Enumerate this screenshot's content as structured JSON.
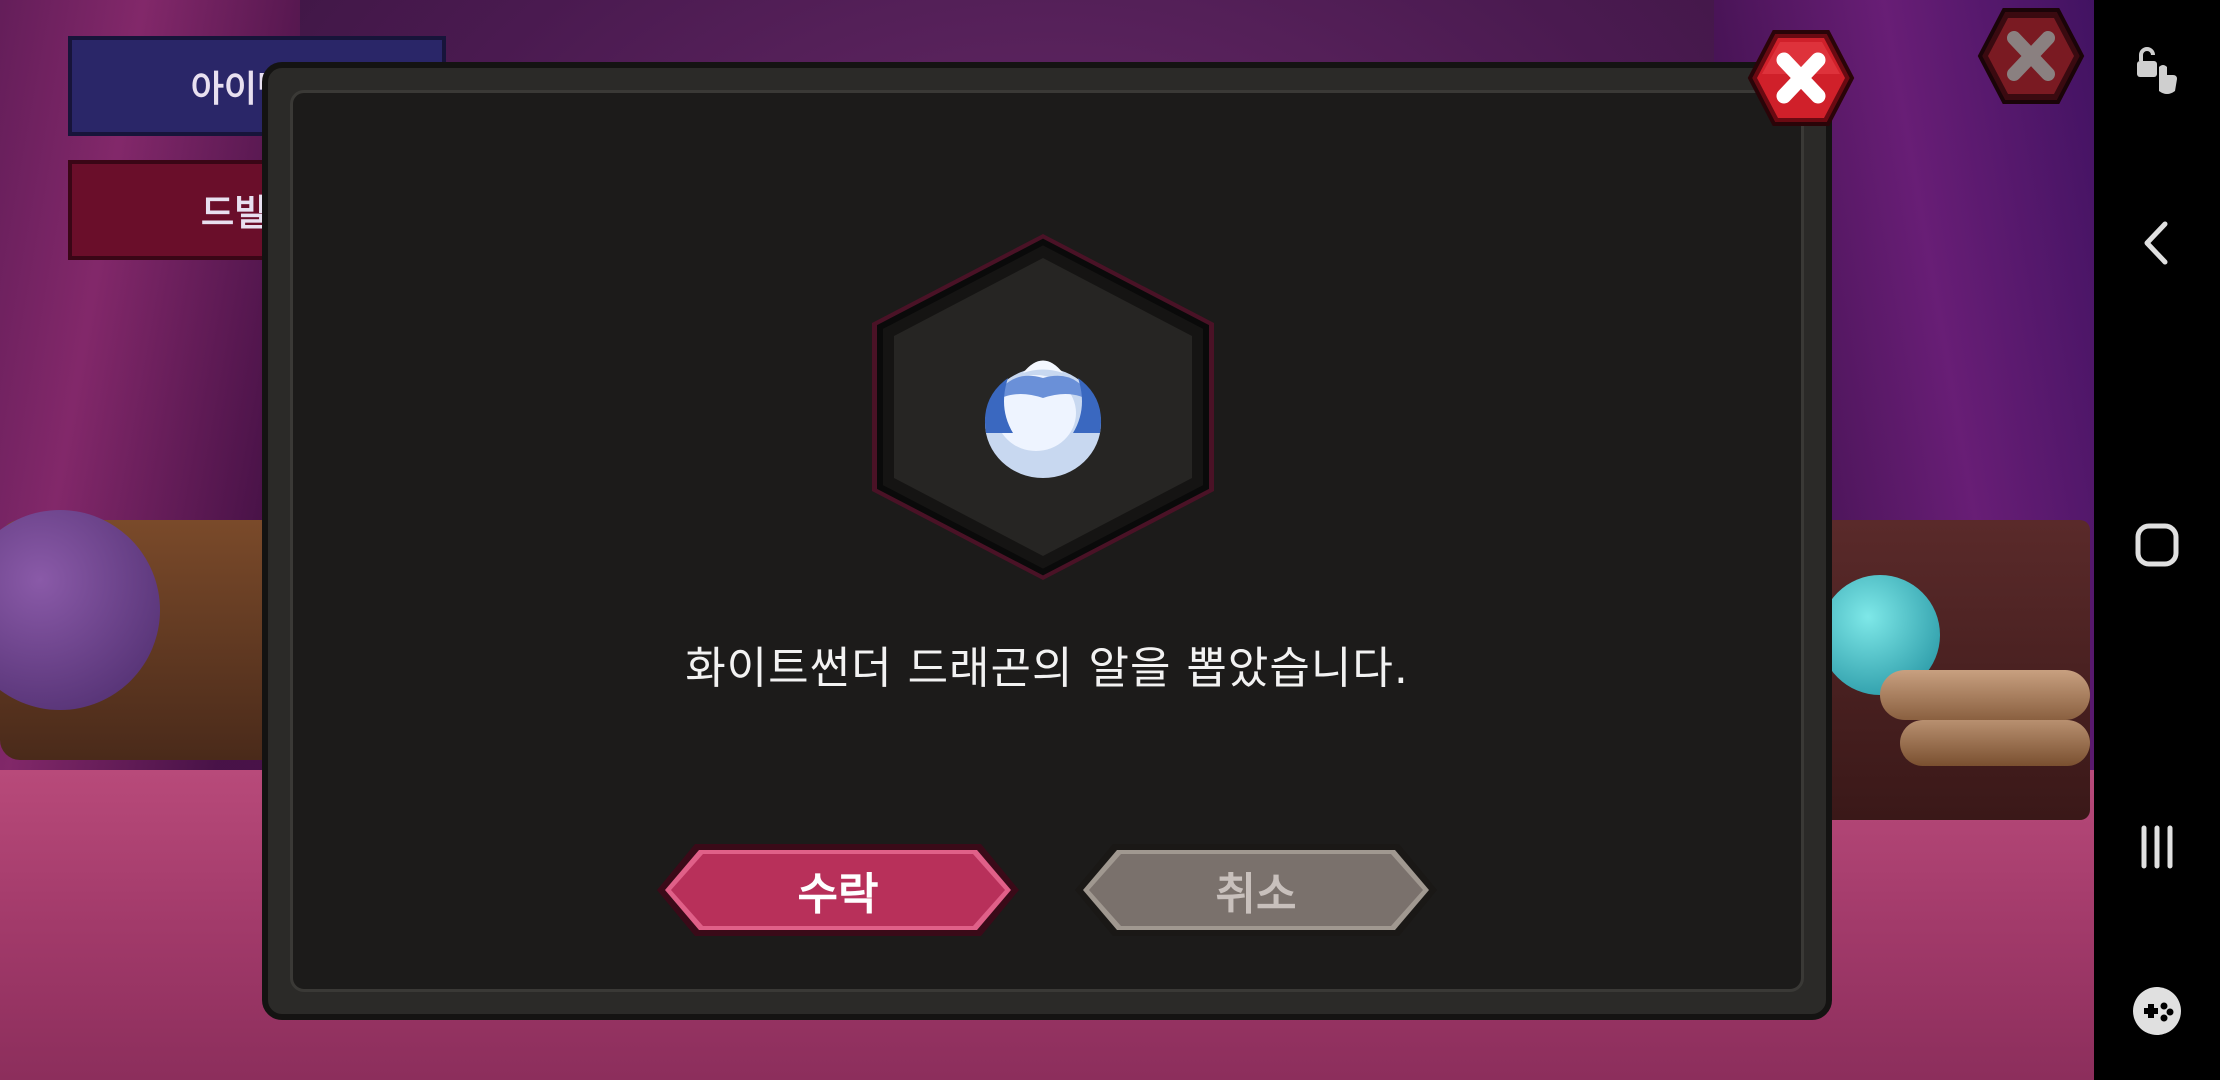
{
  "background": {
    "item_code_button_label": "아이템코",
    "drill_button_label": "드빌 가"
  },
  "dialog": {
    "item_icon": "white-thunder-dragon-egg-icon",
    "message": "화이트썬더 드래곤의 알을 뽑았습니다.",
    "accept_label": "수락",
    "cancel_label": "취소"
  },
  "colors": {
    "accept": "#b8305a",
    "cancel": "#7a716c",
    "close_red": "#d0202a",
    "dialog_bg": "#1c1b1a"
  },
  "system_nav": {
    "icons": [
      "screen-pin-icon",
      "back-icon",
      "home-icon",
      "recents-icon",
      "game-tools-icon"
    ]
  }
}
